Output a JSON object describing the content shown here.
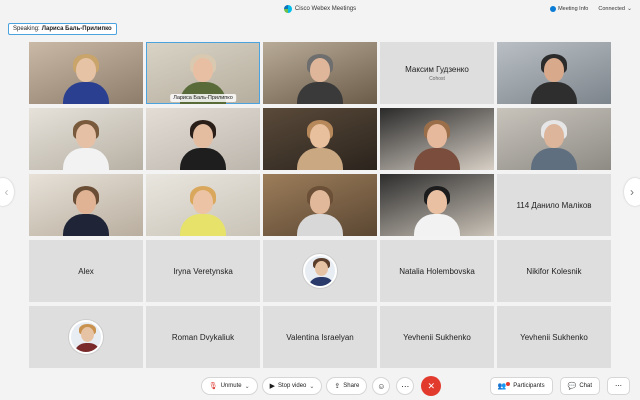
{
  "app": {
    "title": "Cisco Webex Meetings"
  },
  "topbar": {
    "meeting_info": "Meeting Info",
    "status": "Connected"
  },
  "speaking": {
    "label": "Speaking:",
    "name": "Лариса Баль-Прилипко"
  },
  "grid": {
    "row1": {
      "t2_name": "Лариса Баль-Прилипко",
      "t4_name": "Максим Гудзенко",
      "t4_role": "Cohost"
    },
    "row3": {
      "t5_name": "114 Данило Маліков"
    },
    "row4": {
      "t1": "Alex",
      "t2": "Iryna Veretynska",
      "t4": "Natalia Holembovska",
      "t5": "Nikifor Kolesnik"
    },
    "row5": {
      "t2": "Roman Dvykaliuk",
      "t3": "Valentina Israelyan",
      "t4": "Yevhenii Sukhenko",
      "t5": "Yevhenii Sukhenko"
    }
  },
  "controls": {
    "unmute": "Unmute",
    "stop_video": "Stop video",
    "share": "Share",
    "participants": "Participants",
    "chat": "Chat"
  },
  "icons": {
    "logo": "cisco-webex-logo",
    "mic": "mic-muted-icon",
    "video": "video-icon",
    "share": "share-icon",
    "reactions": "emoji-icon",
    "more": "more-icon",
    "end": "end-call-icon"
  },
  "colors": {
    "accent": "#4aa3df",
    "end_call": "#e23b2e",
    "muted": "#d93025"
  }
}
